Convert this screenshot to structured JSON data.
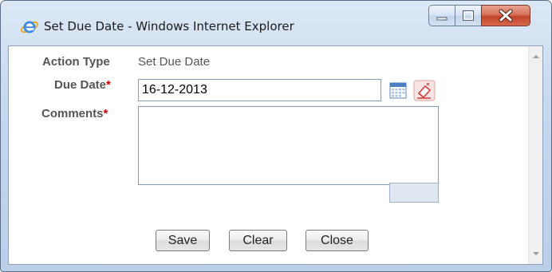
{
  "window": {
    "title": "Set Due Date - Windows Internet Explorer",
    "icon": "internet-explorer-icon"
  },
  "form": {
    "action_type_label": "Action Type",
    "action_type_value": "Set Due Date",
    "due_date_label": "Due Date",
    "due_date_value": "16-12-2013",
    "comments_label": "Comments",
    "comments_value": "",
    "required_marker": "*"
  },
  "icons": {
    "calendar": "calendar-icon",
    "clear_date": "eraser-icon"
  },
  "buttons": {
    "save": "Save",
    "clear": "Clear",
    "close": "Close"
  },
  "colors": {
    "required": "#cc0000",
    "label": "#555555",
    "close_button": "#c2442a"
  }
}
